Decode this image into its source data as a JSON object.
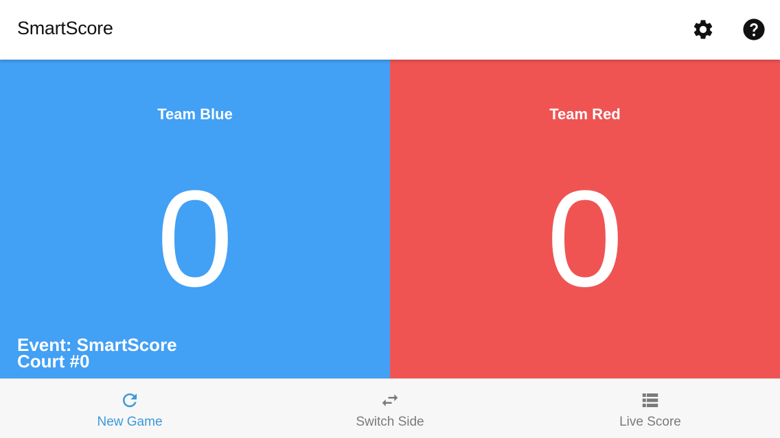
{
  "header": {
    "title": "SmartScore",
    "settings_icon": "gear-icon",
    "help_icon": "question-circle-icon"
  },
  "teams": [
    {
      "name": "Team Blue",
      "score": "0",
      "color": "#42a0f5"
    },
    {
      "name": "Team Red",
      "score": "0",
      "color": "#ef5453"
    }
  ],
  "event": {
    "event_line": "Event: SmartScore",
    "court_line": "Court #0"
  },
  "tabs": [
    {
      "label": "New Game",
      "icon": "refresh-icon",
      "active": true
    },
    {
      "label": "Switch Side",
      "icon": "swap-arrows-icon",
      "active": false
    },
    {
      "label": "Live Score",
      "icon": "list-icon",
      "active": false
    }
  ],
  "colors": {
    "active_tab": "#3a9ad9",
    "inactive_tab": "#7a7a7a",
    "header_bg": "#ffffff",
    "bottom_bar_bg": "#f7f7f7"
  }
}
